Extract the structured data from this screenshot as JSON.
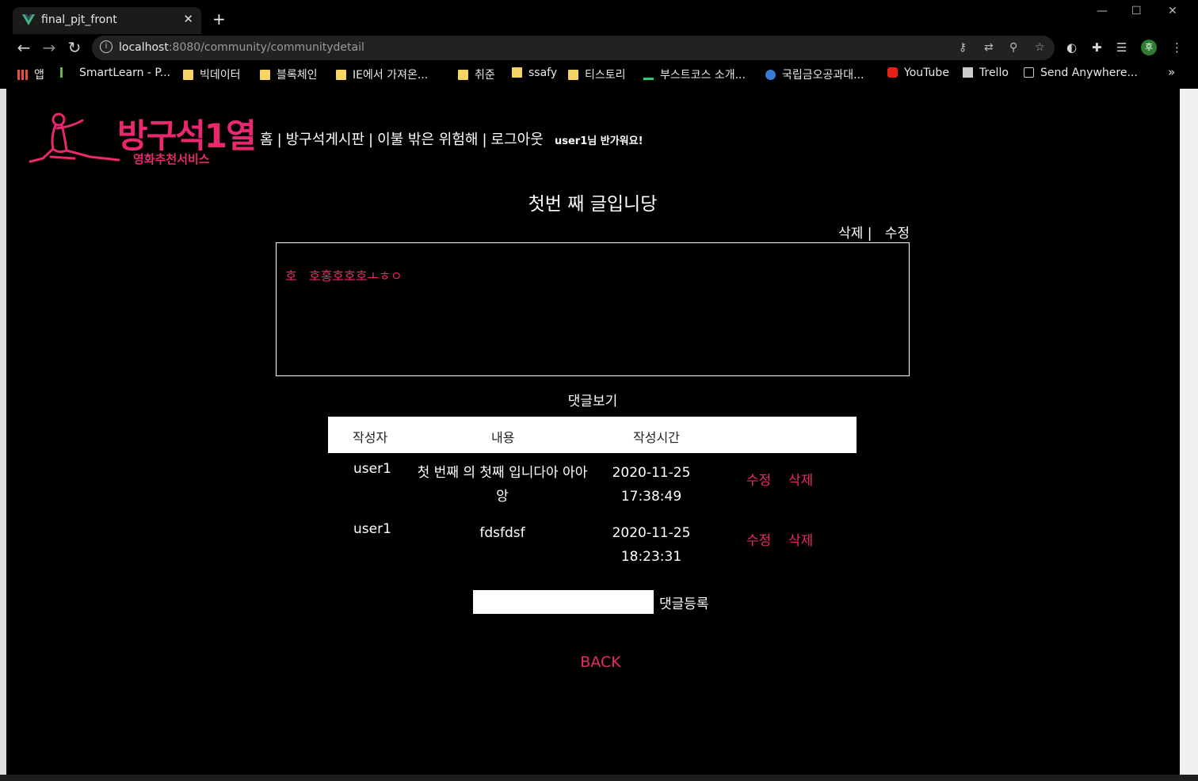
{
  "browser": {
    "tab_title": "final_pjt_front",
    "url_host": "localhost",
    "url_path": ":8080/community/communitydetail",
    "bookmarks": [
      "앱",
      "SmartLearn - P...",
      "빅데이터",
      "블록체인",
      "IE에서 가져온...",
      "취준",
      "ssafy",
      "티스토리",
      "부스트코스 소개...",
      "국립금오공과대...",
      "YouTube",
      "Trello",
      "Send Anywhere..."
    ],
    "profile_initial": "후"
  },
  "header": {
    "logo_title": "방구석1열",
    "logo_subtitle": "영화추천서비스",
    "nav": [
      "홈",
      "방구석게시판",
      "이불 밖은 위험해",
      "로그아웃"
    ],
    "greeting": "user1님 반가워요!"
  },
  "post": {
    "title": "첫번 째 글입니당",
    "delete_label": "삭제",
    "edit_label": "수정",
    "content": "호   호홍호호호ㅗㅎㅇ"
  },
  "comments": {
    "heading": "댓글보기",
    "columns": [
      "작성자",
      "내용",
      "작성시간"
    ],
    "rows": [
      {
        "author": "user1",
        "body": "첫 번째 의 첫째 입니다아 아아앙",
        "time": "2020-11-25 17:38:49",
        "edit": "수정",
        "delete": "삭제"
      },
      {
        "author": "user1",
        "body": "fdsfdsf",
        "time": "2020-11-25 18:23:31",
        "edit": "수정",
        "delete": "삭제"
      }
    ],
    "input_value": "",
    "submit_label": "댓글등록"
  },
  "back_label": "BACK",
  "colors": {
    "accent": "#e8286f",
    "background": "#000000"
  }
}
